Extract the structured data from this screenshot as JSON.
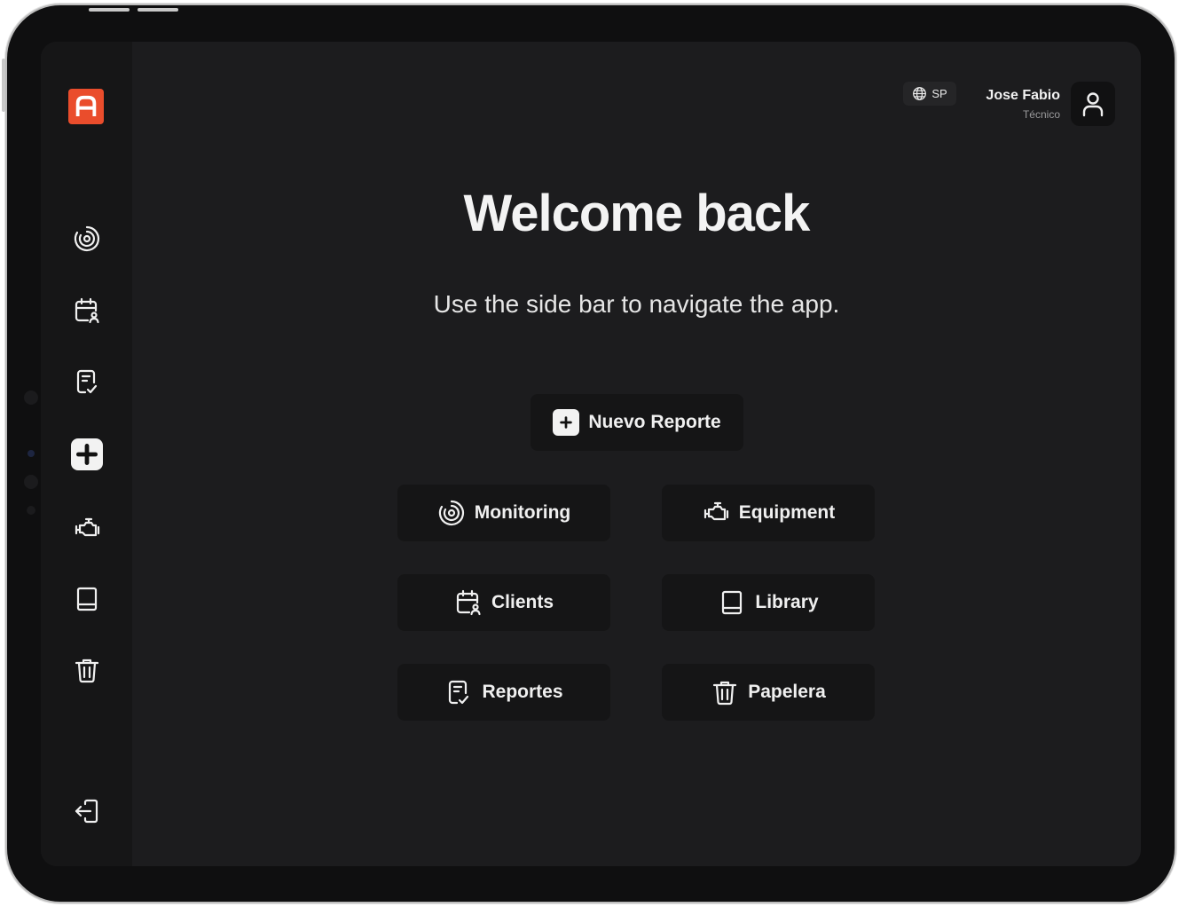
{
  "brand": {
    "logo_icon": "app-logo-a",
    "accent_color": "#ea4d2c"
  },
  "sidebar": {
    "items": [
      {
        "name": "monitoring",
        "icon": "monitoring-icon"
      },
      {
        "name": "clients",
        "icon": "calendar-user-icon"
      },
      {
        "name": "reports",
        "icon": "report-check-icon"
      },
      {
        "name": "new-report",
        "icon": "plus-icon"
      },
      {
        "name": "equipment",
        "icon": "engine-icon"
      },
      {
        "name": "library",
        "icon": "book-icon"
      },
      {
        "name": "trash",
        "icon": "trash-icon"
      }
    ],
    "logout_icon": "logout-icon"
  },
  "header": {
    "language": "SP",
    "language_icon": "globe-icon",
    "user_name": "Jose Fabio",
    "user_role": "Técnico",
    "avatar_icon": "user-icon"
  },
  "main": {
    "title": "Welcome back",
    "subtitle": "Use the side bar to navigate the app.",
    "primary_button": "Nuevo Reporte",
    "buttons": {
      "monitoring": "Monitoring",
      "equipment": "Equipment",
      "clients": "Clients",
      "library": "Library",
      "reportes": "Reportes",
      "papelera": "Papelera"
    }
  }
}
